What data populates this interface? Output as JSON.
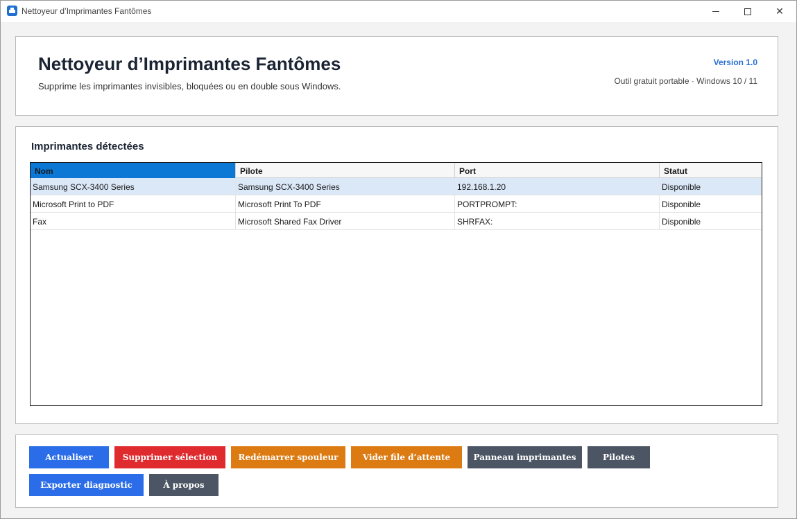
{
  "window": {
    "title": "Nettoyeur d’Imprimantes Fantômes",
    "app_icon": "printer-icon",
    "controls": [
      "minimize-icon",
      "maximize-icon",
      "close-icon"
    ],
    "close_glyph": "✕"
  },
  "header": {
    "title": "Nettoyeur d’Imprimantes Fantômes",
    "subtitle": "Supprime les imprimantes invisibles, bloquées ou en double sous Windows.",
    "version": "Version 1.0",
    "info": "Outil gratuit portable · Windows 10 / 11"
  },
  "printers": {
    "title": "Imprimantes détectées",
    "columns": [
      "Nom",
      "Pilote",
      "Port",
      "Statut"
    ],
    "rows": [
      {
        "name": "Samsung SCX-3400 Series",
        "driver": "Samsung SCX-3400 Series",
        "port": "192.168.1.20",
        "status": "Disponible"
      },
      {
        "name": "Microsoft Print to PDF",
        "driver": "Microsoft Print To PDF",
        "port": "PORTPROMPT:",
        "status": "Disponible"
      },
      {
        "name": "Fax",
        "driver": "Microsoft Shared Fax Driver",
        "port": "SHRFAX:",
        "status": "Disponible"
      }
    ]
  },
  "actions": {
    "refresh": "Actualiser",
    "delete_selection": "Supprimer sélection",
    "restart_spooler": "Redémarrer spouleur",
    "clear_queue": "Vider file d’attente",
    "printers_panel": "Panneau imprimantes",
    "drivers": "Pilotes",
    "export_diagnostic": "Exporter diagnostic",
    "about": "À propos"
  },
  "colors": {
    "blue": "#2b6de8",
    "red": "#df2a2e",
    "orange": "#dc7b12",
    "gray": "#4b5563",
    "selection": "#dbe8f8",
    "header_active": "#0b78d6"
  }
}
